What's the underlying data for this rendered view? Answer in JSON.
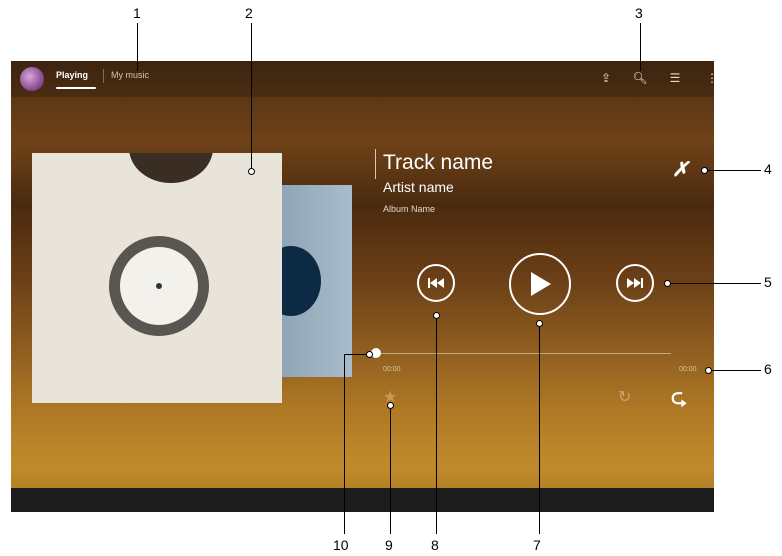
{
  "tabs": {
    "playing": "Playing",
    "my_music": "My music"
  },
  "track": {
    "name": "Track name",
    "artist": "Artist name",
    "album": "Album Name"
  },
  "player": {
    "elapsed": "00:00",
    "total": "00:00"
  },
  "icons": {
    "app": "walkman-app-icon",
    "toolbar": [
      "upload-icon",
      "search-icon",
      "visualizer-icon",
      "overflow-menu-icon"
    ],
    "shuffle": "shuffle-icon",
    "previous": "previous-track-icon",
    "play": "play-icon",
    "next": "next-track-icon",
    "favorite": "star-icon",
    "repeat": "repeat-icon"
  },
  "callouts": [
    "1",
    "2",
    "3",
    "4",
    "5",
    "6",
    "7",
    "8",
    "9",
    "10"
  ]
}
